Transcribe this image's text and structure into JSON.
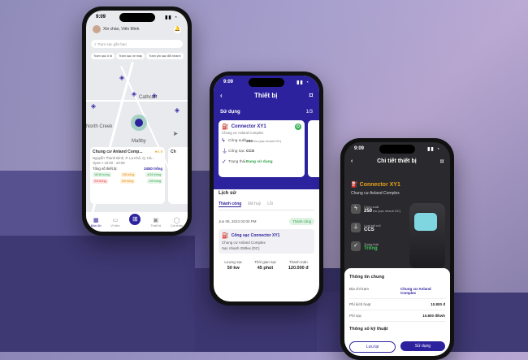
{
  "phone1": {
    "time": "9:09",
    "greeting": "Xin chào, Viên Minh",
    "search_placeholder": "Trạm sạc gần bạn",
    "chips": [
      "Trạm sạc ô tô",
      "Trạm sạc xe máy",
      "Trạm pin sạc đổi nhanh"
    ],
    "map_labels": [
      "Cathcart",
      "North Creek",
      "Maltby"
    ],
    "card": {
      "title": "Chung cư Anland Comp...",
      "rating": "4.9",
      "address": "Nguyễn Thanh Bình, P. La Khê, Q. Hà...",
      "hours": "Open  •  10:00 - 23:00",
      "total_label": "Tổng số thiết bị:",
      "total_value": "24/40 trống",
      "tags": [
        "16/16 trống",
        "0/8 trống",
        "4/16 trống",
        "2/4 trống",
        "0/8 trống",
        "2/8 trống"
      ]
    },
    "card2_title": "Ch",
    "tabs": [
      "Bản đồ",
      "Ví tiền",
      "Thiết bị",
      "Cá nhân"
    ]
  },
  "phone2": {
    "time": "9:09",
    "title": "Thiết bị",
    "section": "Sử dụng",
    "page": "1/3",
    "device": {
      "name": "Connector XY1",
      "place": "Chung cư Anland Complex",
      "power_label": "Công suất",
      "power_value": "250",
      "power_unit": "kw (sạc nhanh DC)",
      "plug_label": "Cổng sạc",
      "plug_value": "CCS",
      "state_label": "Trạng thái",
      "state_value": "Đang sử dụng"
    },
    "history_title": "Lịch sử",
    "history_tabs": [
      "Thành công",
      "Đã huỷ",
      "Lỗi"
    ],
    "record": {
      "datetime": "Jun 08, 2023  02:00 PM",
      "status": "Thành công",
      "port": "Cổng sạc Connector XY1",
      "place": "Chung cư Anland Complex",
      "speed": "Sạc nhanh 250kw (DC)",
      "stats": [
        {
          "label": "Lượng sạc",
          "value": "50 kw"
        },
        {
          "label": "Thời gian sạc",
          "value": "45 phút"
        },
        {
          "label": "Thanh toán",
          "value": "120.000 đ"
        }
      ]
    }
  },
  "phone3": {
    "time": "9:09",
    "title": "Chi tiết thiết bị",
    "device_name": "Connector XY1",
    "place": "Chung cư Anland Complex",
    "specs": [
      {
        "label": "Công suất",
        "value": "250",
        "unit": "kw (sạc nhanh DC)"
      },
      {
        "label": "Loại kết nối",
        "value": "CCS",
        "unit": ""
      },
      {
        "label": "Trạng thái",
        "value": "Trống",
        "unit": ""
      }
    ],
    "sheet": {
      "title": "Thông tin chung",
      "rows": [
        {
          "k": "Địa chỉ trạm",
          "v": "Chung cư Anland Complex"
        },
        {
          "k": "Phí kích hoạt",
          "v": "10.800 đ"
        },
        {
          "k": "Phí sạc",
          "v": "10.800 đ/kwh"
        }
      ],
      "tech_title": "Thông số kỹ thuật",
      "save": "Lưu lại",
      "use": "Sử dụng"
    }
  }
}
